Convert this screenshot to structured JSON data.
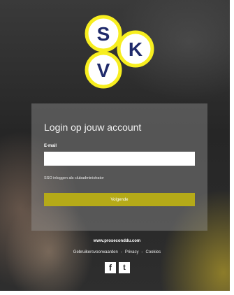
{
  "logo": {
    "letters": [
      "S",
      "K",
      "V"
    ],
    "ring_color": "#f7ee1f",
    "text_color": "#1f2a6b",
    "fill_color": "#ffffff"
  },
  "login": {
    "title": "Login op jouw account",
    "email_label": "E-mail",
    "email_value": "",
    "admin_link": "SSO inloggen als clubadministrator",
    "next_button": "Volgende",
    "accent_color": "#b5aa18"
  },
  "footer": {
    "url": "www.proseconddu.com",
    "links": [
      "Gebruikersvoorwaarden",
      "Privacy",
      "Cookies"
    ],
    "separator": "-"
  },
  "social": {
    "icons": [
      "facebook-icon",
      "twitter-icon"
    ],
    "facebook_glyph": "f",
    "twitter_glyph": "t"
  }
}
